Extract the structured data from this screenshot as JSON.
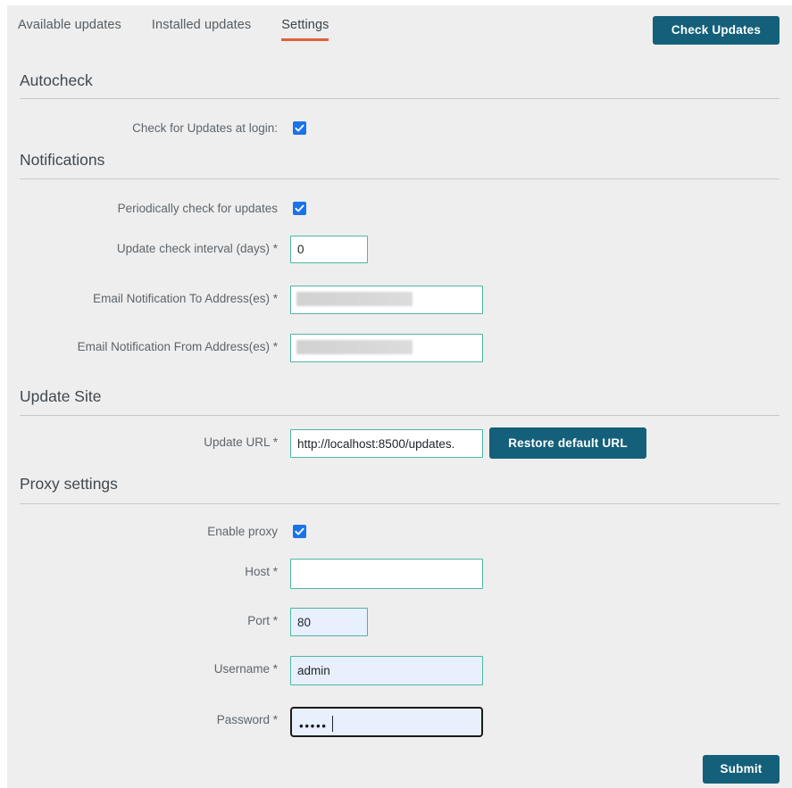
{
  "tabs": [
    {
      "label": "Available updates",
      "active": false
    },
    {
      "label": "Installed updates",
      "active": false
    },
    {
      "label": "Settings",
      "active": true
    }
  ],
  "toolbar": {
    "check_updates_label": "Check Updates"
  },
  "sections": {
    "autocheck": {
      "title": "Autocheck",
      "check_at_login_label": "Check for Updates at login:",
      "check_at_login_checked": true
    },
    "notifications": {
      "title": "Notifications",
      "periodic_label": "Periodically check for updates",
      "periodic_checked": true,
      "interval_label": "Update check interval (days) *",
      "interval_value": "0",
      "email_to_label": "Email Notification To Address(es) *",
      "email_to_value": "",
      "email_from_label": "Email Notification From Address(es) *",
      "email_from_value": ""
    },
    "update_site": {
      "title": "Update Site",
      "url_label": "Update URL *",
      "url_value": "http://localhost:8500/updates.",
      "restore_label": "Restore default URL"
    },
    "proxy": {
      "title": "Proxy settings",
      "enable_label": "Enable proxy",
      "enable_checked": true,
      "host_label": "Host *",
      "host_value": "",
      "port_label": "Port *",
      "port_value": "80",
      "username_label": "Username *",
      "username_value": "admin",
      "password_label": "Password *",
      "password_value": "•••••"
    }
  },
  "footer": {
    "submit_label": "Submit"
  },
  "colors": {
    "accent_button": "#14607a",
    "active_tab_underline": "#e1613c",
    "field_border": "#4db6a4",
    "checkbox": "#1a73e8",
    "page_background": "#eeeeee"
  }
}
